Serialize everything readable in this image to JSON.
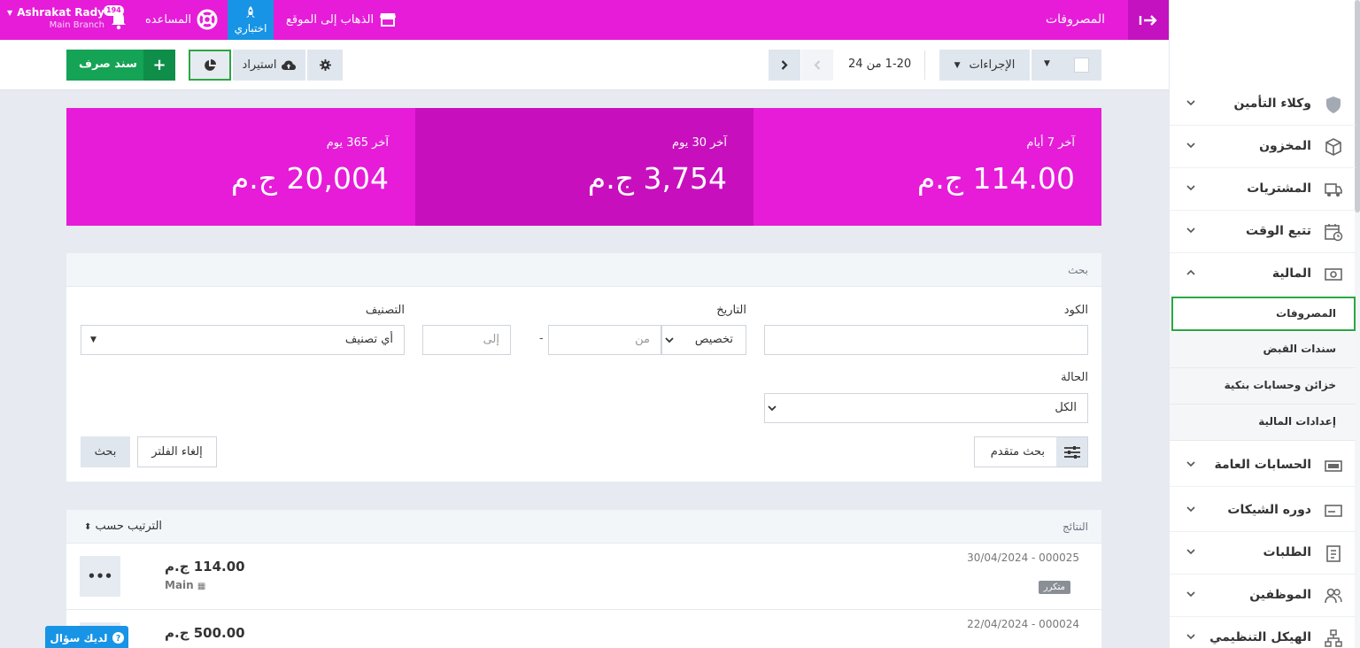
{
  "topbar": {
    "title": "المصروفات",
    "user_name": "Ashrakat Rady",
    "user_branch": "Main Branch",
    "notifications": "194",
    "help_label": "المساعده",
    "trial_label": "اختباري",
    "site_label": "الذهاب إلى الموقع"
  },
  "toolbar": {
    "primary_label": "سند صرف",
    "import_label": "استيراد",
    "pager_text": "1-20  من 24",
    "actions_label": "الإجراءات"
  },
  "stats": [
    {
      "label": "آخر 7 أيام",
      "value": "114.00 ج.م"
    },
    {
      "label": "آخر 30 يوم",
      "value": "3,754 ج.م"
    },
    {
      "label": "آخر 365 يوم",
      "value": "20,004 ج.م"
    }
  ],
  "search": {
    "title": "بحث",
    "code_label": "الكود",
    "date_label": "التاريخ",
    "date_mode": "تخصيص",
    "from_placeholder": "من",
    "to_placeholder": "إلى",
    "category_label": "التصنيف",
    "category_value": "أي تصنيف",
    "status_label": "الحالة",
    "status_value": "الكل",
    "advanced_label": "بحث متقدم",
    "clear_label": "إلغاء الفلتر",
    "search_label": "بحث"
  },
  "results": {
    "title": "النتائج",
    "sort_label": "الترتيب حسب",
    "rows": [
      {
        "ref": "30/04/2024 - 000025",
        "amount": "114.00 ج.م",
        "branch": "Main",
        "badge": "متكرر"
      },
      {
        "ref": "22/04/2024 - 000024",
        "amount": "500.00 ج.م",
        "branch": "",
        "badge": ""
      }
    ]
  },
  "help_float": "لديك سؤال",
  "sidebar": {
    "items_top": [
      {
        "label": "وكلاء التأمين",
        "icon": "shield-icon"
      },
      {
        "label": "المخزون",
        "icon": "box-icon"
      },
      {
        "label": "المشتريات",
        "icon": "truck-icon"
      },
      {
        "label": "تتبع الوقت",
        "icon": "calendar-clock-icon"
      },
      {
        "label": "المالية",
        "icon": "money-icon"
      }
    ],
    "finance_sub": [
      "المصروفات",
      "سندات القبض",
      "خزائن وحسابات بنكية",
      "إعدادات المالية"
    ],
    "items_bottom": [
      {
        "label": "الحسابات العامة",
        "icon": "accounts-icon"
      },
      {
        "label": "دوره الشيكات",
        "icon": "cheque-icon"
      },
      {
        "label": "الطلبات",
        "icon": "clipboard-icon"
      },
      {
        "label": "الموظفين",
        "icon": "users-icon"
      },
      {
        "label": "الهيكل التنظيمي",
        "icon": "org-icon"
      }
    ]
  }
}
